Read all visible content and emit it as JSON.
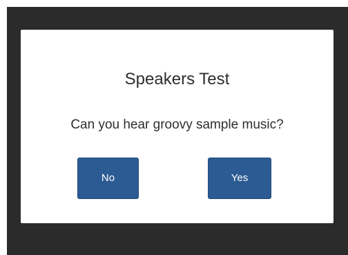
{
  "dialog": {
    "title": "Speakers Test",
    "message": "Can you hear groovy sample music?",
    "buttons": {
      "no_label": "No",
      "yes_label": "Yes"
    }
  },
  "colors": {
    "backdrop": "#2b2b2b",
    "dialog_background": "#ffffff",
    "button_primary": "#2c5b93",
    "text": "#2e2e2e"
  }
}
